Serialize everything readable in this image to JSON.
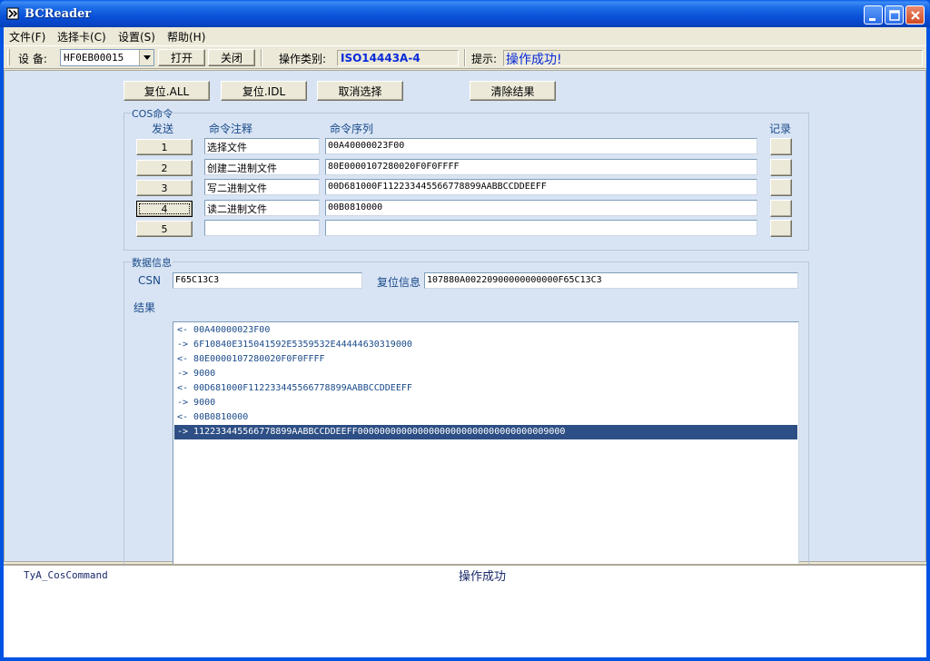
{
  "window": {
    "title": "BCReader"
  },
  "menu": [
    "文件(F)",
    "选择卡(C)",
    "设置(S)",
    "帮助(H)"
  ],
  "toolbar": {
    "device_label": "设 备:",
    "device_value": "HF0EB00015",
    "open_label": "打开",
    "close_label": "关闭",
    "op_type_label": "操作类别:",
    "op_type_value": "ISO14443A-4",
    "hint_label": "提示:",
    "hint_value": "操作成功!"
  },
  "actions": {
    "reset_all": "复位.ALL",
    "reset_idl": "复位.IDL",
    "cancel_select": "取消选择",
    "clear_results": "清除结果"
  },
  "cos": {
    "title": "COS命令",
    "headers": {
      "send": "发送",
      "comment": "命令注释",
      "sequence": "命令序列",
      "record": "记录"
    },
    "rows": [
      {
        "send": "1",
        "comment": "选择文件",
        "sequence": "00A40000023F00"
      },
      {
        "send": "2",
        "comment": "创建二进制文件",
        "sequence": "80E0000107280020F0F0FFFF"
      },
      {
        "send": "3",
        "comment": "写二进制文件",
        "sequence": "00D681000F112233445566778899AABBCCDDEEFF"
      },
      {
        "send": "4",
        "comment": "读二进制文件",
        "sequence": "00B0810000"
      },
      {
        "send": "5",
        "comment": "",
        "sequence": ""
      }
    ]
  },
  "data_info": {
    "title": "数据信息",
    "csn_label": "CSN",
    "csn_value": "F65C13C3",
    "reset_info_label": "复位信息",
    "reset_info_value": "107880A00220900000000000F65C13C3",
    "result_label": "结果",
    "log": [
      "<- 00A40000023F00",
      "-> 6F10840E315041592E5359532E44444630319000",
      "<- 80E0000107280020F0F0FFFF",
      "-> 9000",
      "<- 00D681000F112233445566778899AABBCCDDEEFF",
      "-> 9000",
      "<- 00B0810000",
      "-> 112233445566778899AABBCCDDEEFF00000000000000000000000000000000009000"
    ],
    "selected_index": 7
  },
  "status": {
    "left": "TyA_CosCommand",
    "center": "操作成功"
  },
  "colors": {
    "title_blue": "#0054e3",
    "panel": "#d8e4f4",
    "selection": "#2d4f85",
    "hint_text": "#0a2ad8"
  }
}
